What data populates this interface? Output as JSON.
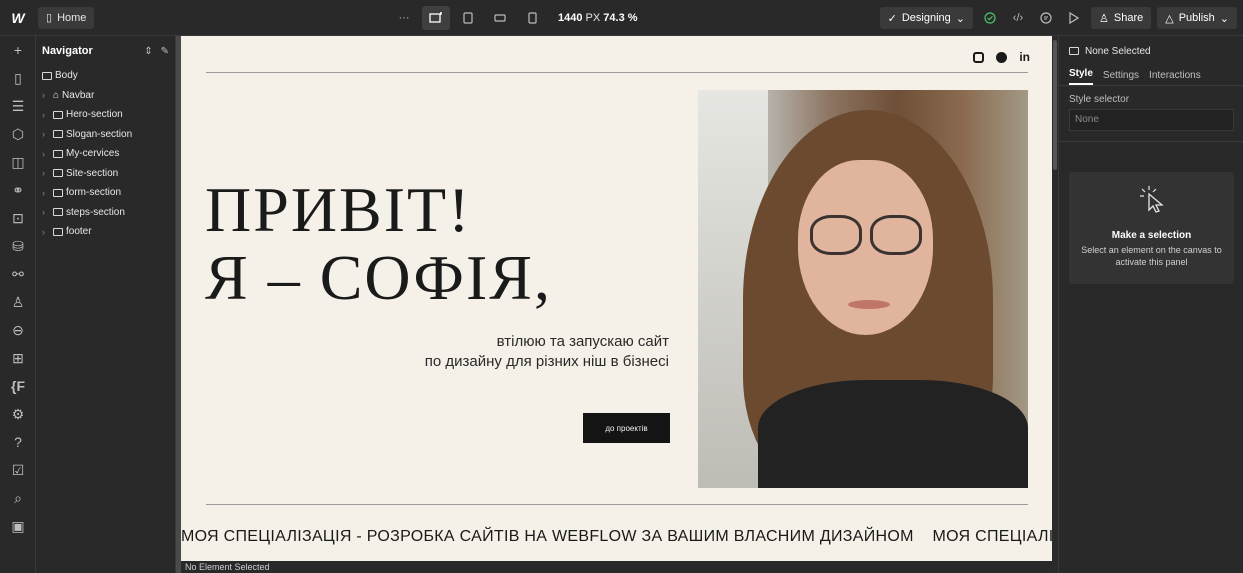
{
  "topbar": {
    "logo": "W",
    "page": "Home",
    "more": "···",
    "width": "1440",
    "unit": "PX",
    "zoom": "74.3 %",
    "mode": "Designing",
    "share": "Share",
    "publish": "Publish"
  },
  "navigator": {
    "title": "Navigator",
    "items": [
      {
        "label": "Body"
      },
      {
        "label": "Navbar"
      },
      {
        "label": "Hero-section"
      },
      {
        "label": "Slogan-section"
      },
      {
        "label": "My-cervices"
      },
      {
        "label": "Site-section"
      },
      {
        "label": "form-section"
      },
      {
        "label": "steps-section"
      },
      {
        "label": "footer"
      }
    ]
  },
  "canvas": {
    "social": {
      "linkedin": "in"
    },
    "hero_line1": "ПРИВІТ!",
    "hero_line2": "Я – СОФІЯ,",
    "sub_line1": "втілюю та запускаю сайт",
    "sub_line2": "по дизайну для різних ніш в бізнесі",
    "cta": "до проектів",
    "marquee_1": "МОЯ СПЕЦІАЛІЗАЦІЯ - РОЗРОБКА САЙТІВ НА WEBFLOW ЗА ВАШИМ ВЛАСНИМ ДИЗАЙНОМ",
    "marquee_2": "МОЯ СПЕЦІАЛІЗ"
  },
  "statusbar": {
    "text": "No Element Selected"
  },
  "rpanel": {
    "selection": "None Selected",
    "tabs": [
      "Style",
      "Settings",
      "Interactions"
    ],
    "selector_label": "Style selector",
    "selector_value": "None",
    "empty_title": "Make a selection",
    "empty_text": "Select an element on the canvas to activate this panel"
  },
  "colors": {
    "accent_green": "#4ec36b",
    "canvas_bg": "#f5f1e8",
    "ui_bg": "#292929"
  }
}
